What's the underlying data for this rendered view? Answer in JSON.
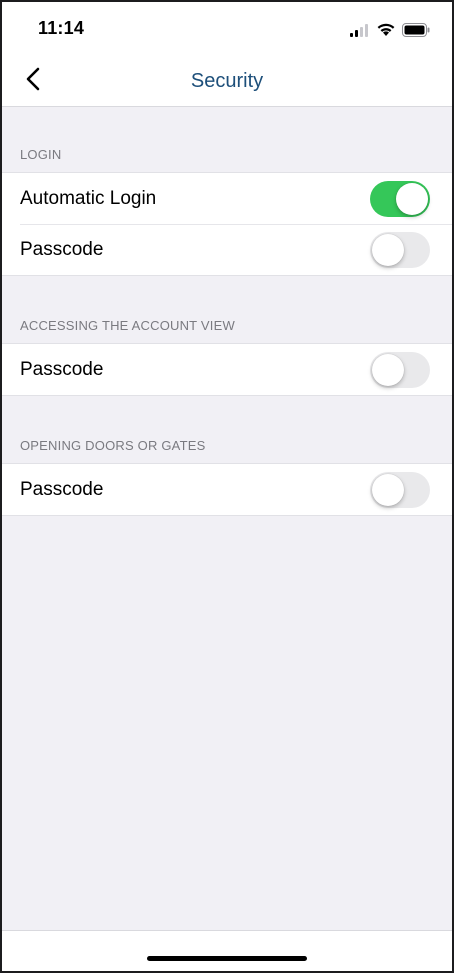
{
  "status_bar": {
    "time": "11:14",
    "icons": [
      "cellular-signal-icon",
      "wifi-icon",
      "battery-icon"
    ]
  },
  "nav": {
    "title": "Security",
    "back_icon": "chevron-left-icon"
  },
  "sections": [
    {
      "header": "LOGIN",
      "rows": [
        {
          "label": "Automatic Login",
          "toggle_on": true
        },
        {
          "label": "Passcode",
          "toggle_on": false
        }
      ]
    },
    {
      "header": "ACCESSING THE ACCOUNT VIEW",
      "rows": [
        {
          "label": "Passcode",
          "toggle_on": false
        }
      ]
    },
    {
      "header": "OPENING DOORS OR GATES",
      "rows": [
        {
          "label": "Passcode",
          "toggle_on": false
        }
      ]
    }
  ],
  "colors": {
    "accent_title": "#1d4f7a",
    "toggle_on": "#35c759",
    "toggle_off": "#e9e9eb",
    "grouped_background": "#f1f0f5"
  }
}
